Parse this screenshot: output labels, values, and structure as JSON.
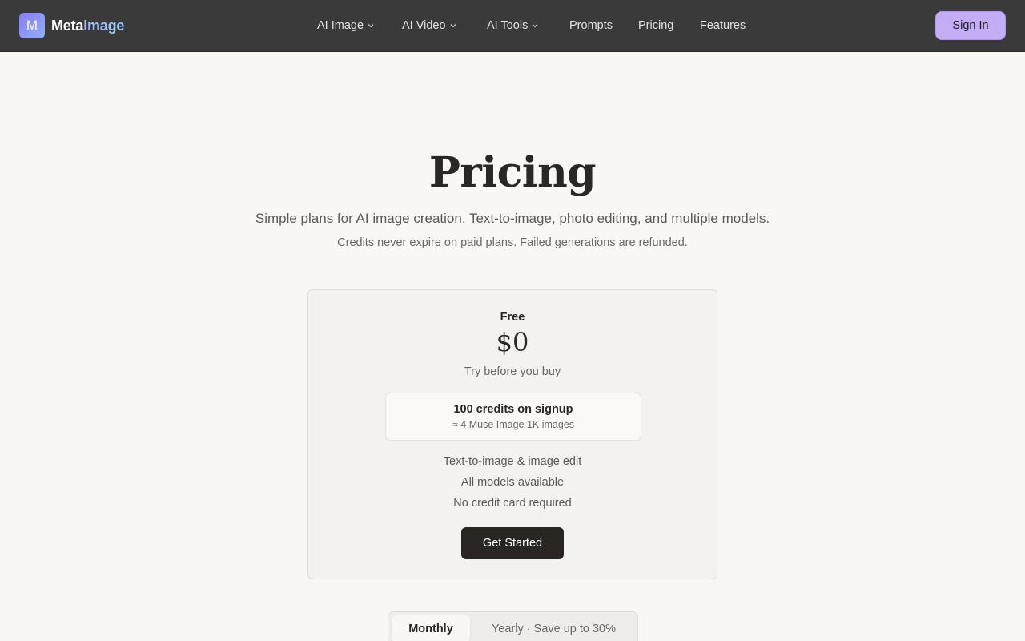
{
  "header": {
    "logo_letter": "M",
    "brand_part1": "Meta",
    "brand_part2": "Image",
    "nav": [
      {
        "label": "AI Image",
        "dropdown": true
      },
      {
        "label": "AI Video",
        "dropdown": true
      },
      {
        "label": "AI Tools",
        "dropdown": true
      },
      {
        "label": "Prompts",
        "dropdown": false
      },
      {
        "label": "Pricing",
        "dropdown": false
      },
      {
        "label": "Features",
        "dropdown": false
      }
    ],
    "signin_label": "Sign In"
  },
  "hero": {
    "title": "Pricing",
    "subtitle": "Simple plans for AI image creation. Text-to-image, photo editing, and multiple models.",
    "note": "Credits never expire on paid plans. Failed generations are refunded."
  },
  "plan": {
    "name": "Free",
    "price": "$0",
    "tagline": "Try before you buy",
    "credits_main": "100 credits on signup",
    "credits_sub": "≈ 4 Muse Image 1K images",
    "features": [
      "Text-to-image & image edit",
      "All models available",
      "No credit card required"
    ],
    "cta_label": "Get Started"
  },
  "billing_toggle": {
    "monthly_label": "Monthly",
    "yearly_label": "Yearly · Save up to 30%",
    "selected": "Monthly"
  },
  "colors": {
    "header_bg": "#3a3a3a",
    "page_bg": "#f8f7f4",
    "signin_bg": "#c3aef5",
    "cta_bg": "#2a2521"
  }
}
